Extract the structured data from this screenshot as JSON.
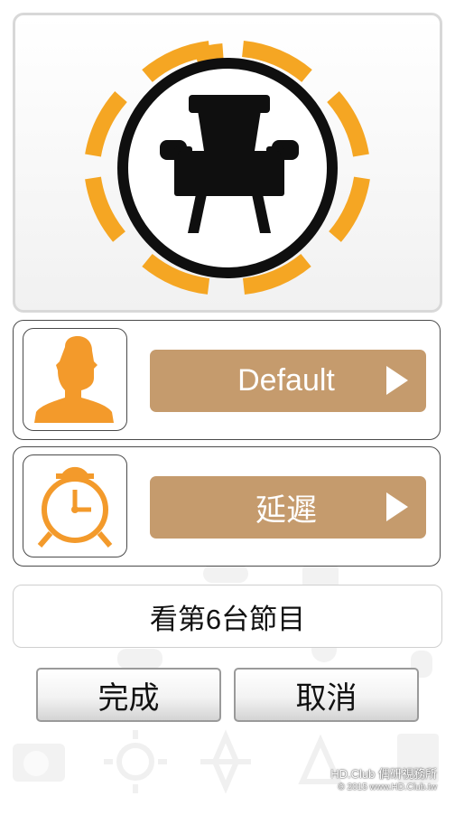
{
  "hero": {
    "icon": "armchair-icon",
    "ring_color": "#f5a623"
  },
  "profile_row": {
    "icon": "person-icon",
    "button_label": "Default"
  },
  "delay_row": {
    "icon": "alarm-clock-icon",
    "button_label": "延遲"
  },
  "command": {
    "text": "看第6台節目"
  },
  "buttons": {
    "done": "完成",
    "cancel": "取消"
  },
  "watermark": {
    "line1": "HD.Club 偶研視務所",
    "line2": "© 2015  www.HD.Club.tw"
  },
  "colors": {
    "accent": "#f5a623",
    "button_brown": "#c59b6d",
    "icon_orange": "#f39a2b"
  }
}
